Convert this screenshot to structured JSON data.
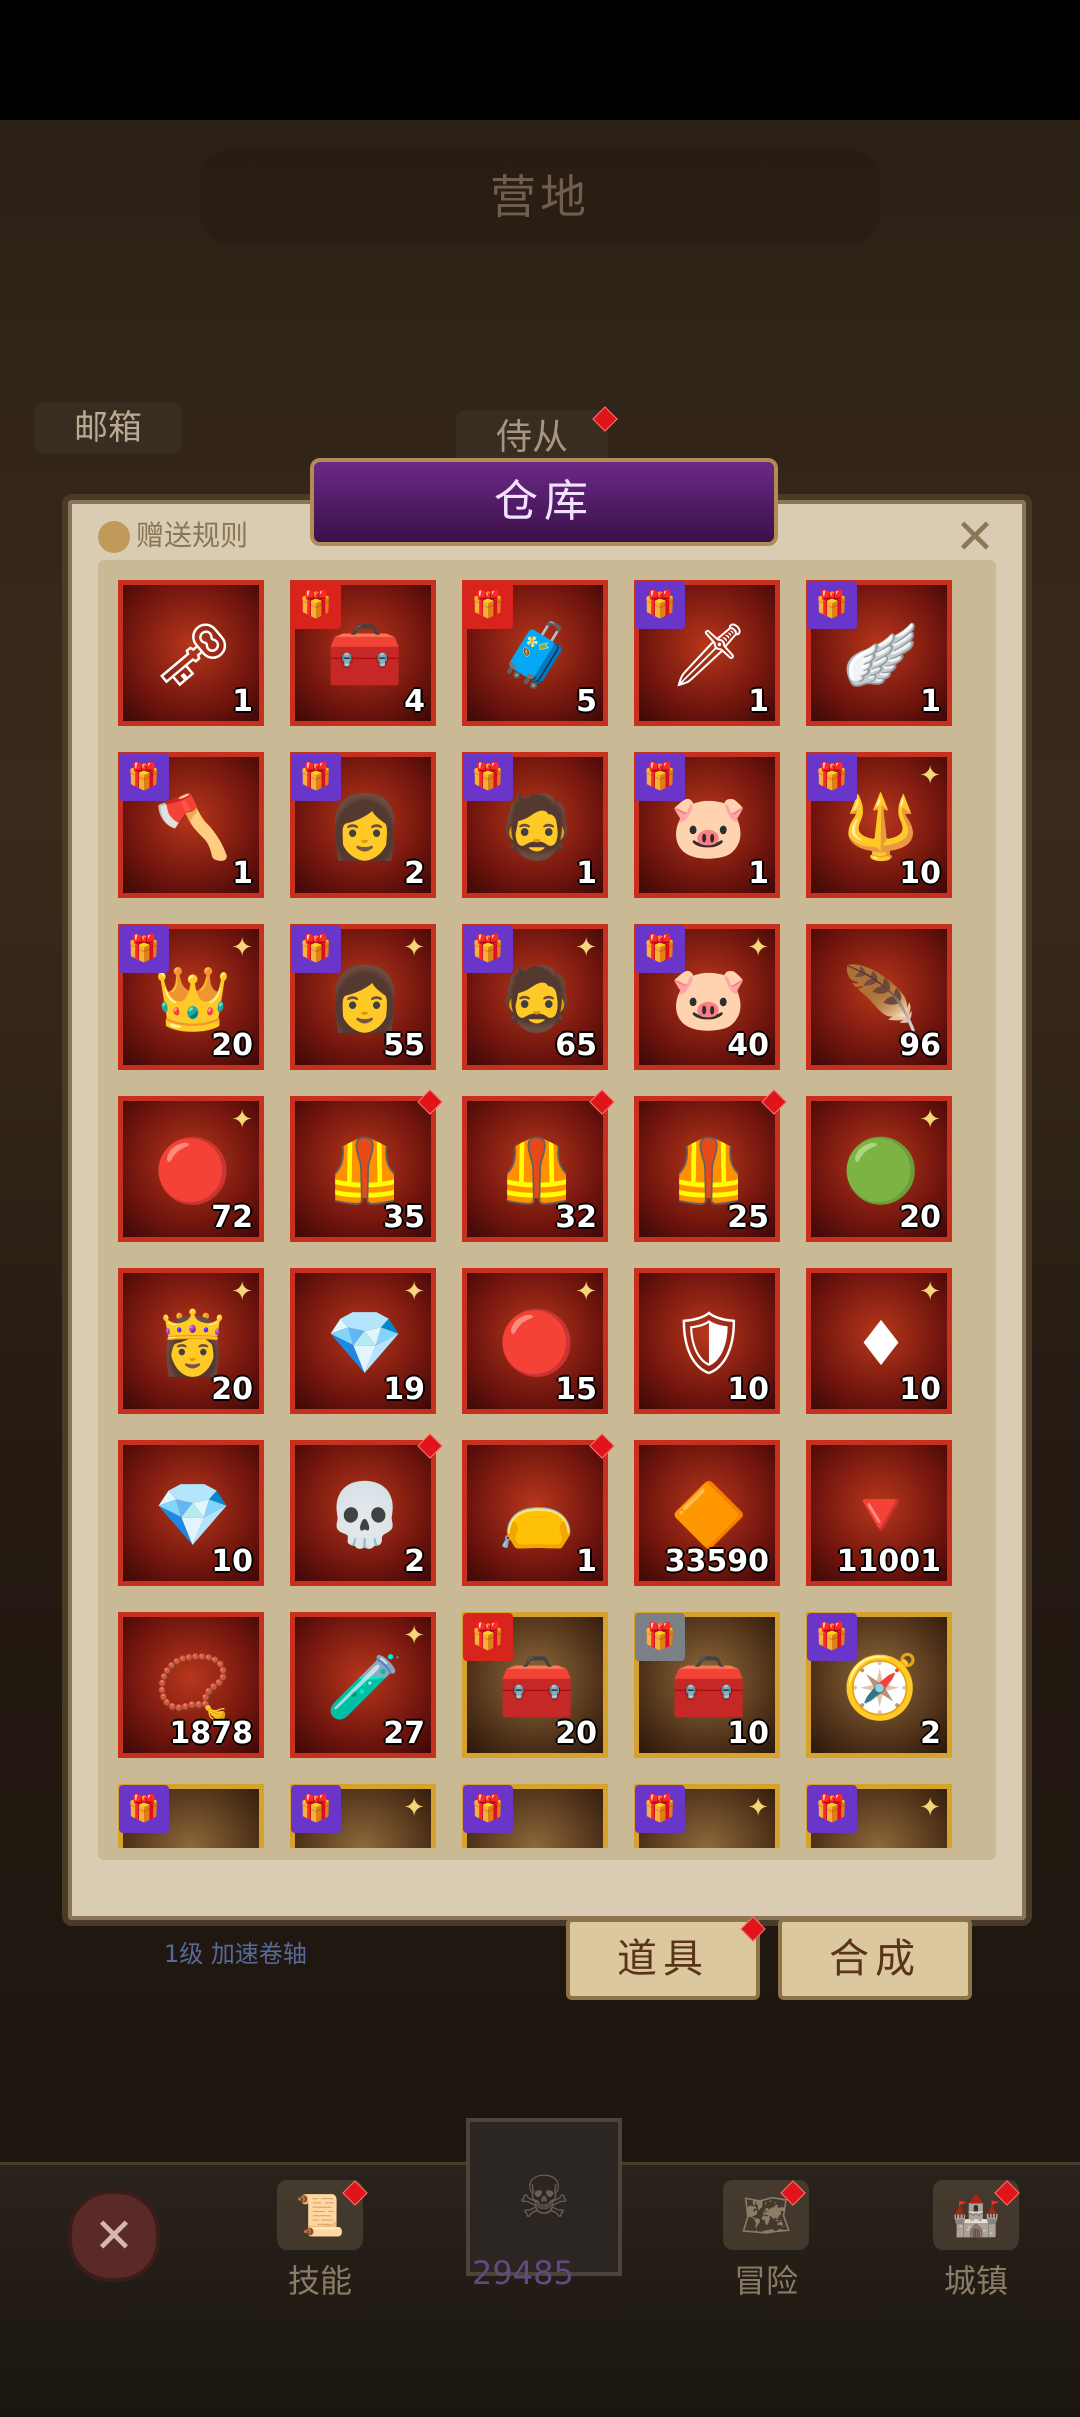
{
  "header": {
    "camp_title": "营地",
    "mailbox_label": "邮箱",
    "attendant_label": "侍从"
  },
  "warehouse": {
    "title": "仓库",
    "rules_label": "赠送规则",
    "close_glyph": "✕",
    "items": [
      {
        "icon": "key-icon",
        "glyph": "🗝",
        "qty": "1",
        "badge": null,
        "dot": false,
        "spark": false,
        "frame": "red"
      },
      {
        "icon": "treasure-chest-icon",
        "glyph": "🧰",
        "qty": "4",
        "badge": "red",
        "dot": false,
        "spark": false,
        "frame": "red"
      },
      {
        "icon": "iron-chest-icon",
        "glyph": "🧳",
        "qty": "5",
        "badge": "red",
        "dot": false,
        "spark": false,
        "frame": "red"
      },
      {
        "icon": "chainsaw-sword-icon",
        "glyph": "🗡",
        "qty": "1",
        "badge": "purple",
        "dot": false,
        "spark": false,
        "frame": "red"
      },
      {
        "icon": "winged-gem-icon",
        "glyph": "🪽",
        "qty": "1",
        "badge": "purple",
        "dot": false,
        "spark": false,
        "frame": "red"
      },
      {
        "icon": "battle-axe-icon",
        "glyph": "🪓",
        "qty": "1",
        "badge": "purple",
        "dot": false,
        "spark": false,
        "frame": "red"
      },
      {
        "icon": "hero-woman-portrait-icon",
        "glyph": "👩",
        "qty": "2",
        "badge": "purple",
        "dot": false,
        "spark": false,
        "frame": "red"
      },
      {
        "icon": "hooded-man-portrait-icon",
        "glyph": "🧔",
        "qty": "1",
        "badge": "purple",
        "dot": false,
        "spark": false,
        "frame": "red"
      },
      {
        "icon": "leopard-hat-portrait-icon",
        "glyph": "🐷",
        "qty": "1",
        "badge": "purple",
        "dot": false,
        "spark": false,
        "frame": "red"
      },
      {
        "icon": "magic-staff-icon",
        "glyph": "🔱",
        "qty": "10",
        "badge": "purple",
        "dot": false,
        "spark": true,
        "frame": "red"
      },
      {
        "icon": "crown-icon",
        "glyph": "👑",
        "qty": "20",
        "badge": "purple",
        "dot": false,
        "spark": true,
        "frame": "red"
      },
      {
        "icon": "hero-woman-shard-icon",
        "glyph": "👩",
        "qty": "55",
        "badge": "purple",
        "dot": false,
        "spark": true,
        "frame": "red"
      },
      {
        "icon": "hooded-man-shard-icon",
        "glyph": "🧔",
        "qty": "65",
        "badge": "purple",
        "dot": false,
        "spark": true,
        "frame": "red"
      },
      {
        "icon": "leopard-hat-shard-icon",
        "glyph": "🐷",
        "qty": "40",
        "badge": "purple",
        "dot": false,
        "spark": true,
        "frame": "red"
      },
      {
        "icon": "golden-feather-icon",
        "glyph": "🪶",
        "qty": "96",
        "badge": null,
        "dot": false,
        "spark": false,
        "frame": "red"
      },
      {
        "icon": "red-orb-amulet-icon",
        "glyph": "🔴",
        "qty": "72",
        "badge": null,
        "dot": false,
        "spark": true,
        "frame": "red"
      },
      {
        "icon": "armor-chestplate-icon",
        "glyph": "🦺",
        "qty": "35",
        "badge": null,
        "dot": true,
        "spark": false,
        "frame": "red"
      },
      {
        "icon": "armor-chestplate-icon",
        "glyph": "🦺",
        "qty": "32",
        "badge": null,
        "dot": true,
        "spark": false,
        "frame": "red"
      },
      {
        "icon": "armor-chestplate-icon",
        "glyph": "🦺",
        "qty": "25",
        "badge": null,
        "dot": true,
        "spark": false,
        "frame": "red"
      },
      {
        "icon": "green-orb-star-icon",
        "glyph": "🟢",
        "qty": "20",
        "badge": null,
        "dot": false,
        "spark": true,
        "frame": "red"
      },
      {
        "icon": "valkyrie-portrait-icon",
        "glyph": "👸",
        "qty": "20",
        "badge": null,
        "dot": false,
        "spark": true,
        "frame": "red"
      },
      {
        "icon": "prism-crystal-icon",
        "glyph": "💎",
        "qty": "19",
        "badge": null,
        "dot": false,
        "spark": true,
        "frame": "red"
      },
      {
        "icon": "red-orb-amulet-icon",
        "glyph": "🔴",
        "qty": "15",
        "badge": null,
        "dot": false,
        "spark": true,
        "frame": "red"
      },
      {
        "icon": "purple-shield-icon",
        "glyph": "🛡",
        "qty": "10",
        "badge": null,
        "dot": false,
        "spark": false,
        "frame": "red"
      },
      {
        "icon": "red-rune-crystal-icon",
        "glyph": "♦",
        "qty": "10",
        "badge": null,
        "dot": false,
        "spark": true,
        "frame": "red"
      },
      {
        "icon": "prism-crystal-icon",
        "glyph": "💎",
        "qty": "10",
        "badge": null,
        "dot": false,
        "spark": false,
        "frame": "red"
      },
      {
        "icon": "skull-chest-icon",
        "glyph": "💀",
        "qty": "2",
        "badge": null,
        "dot": true,
        "spark": false,
        "frame": "red"
      },
      {
        "icon": "skull-pouch-icon",
        "glyph": "👝",
        "qty": "1",
        "badge": null,
        "dot": true,
        "spark": false,
        "frame": "red"
      },
      {
        "icon": "gold-crystal-icon",
        "glyph": "🔶",
        "qty": "33590",
        "badge": null,
        "dot": false,
        "spark": false,
        "frame": "red"
      },
      {
        "icon": "red-gem-icon",
        "glyph": "🔻",
        "qty": "11001",
        "badge": null,
        "dot": false,
        "spark": false,
        "frame": "red"
      },
      {
        "icon": "ruby-pendant-icon",
        "glyph": "📿",
        "qty": "1878",
        "badge": null,
        "dot": false,
        "spark": false,
        "frame": "red"
      },
      {
        "icon": "fire-potion-icon",
        "glyph": "🧪",
        "qty": "27",
        "badge": null,
        "dot": false,
        "spark": true,
        "frame": "red"
      },
      {
        "icon": "silver-chest-icon",
        "glyph": "🧰",
        "qty": "20",
        "badge": "red",
        "dot": false,
        "spark": false,
        "frame": "gold"
      },
      {
        "icon": "silver-chest-icon",
        "glyph": "🧰",
        "qty": "10",
        "badge": "gray",
        "dot": false,
        "spark": false,
        "frame": "gold"
      },
      {
        "icon": "pocket-compass-icon",
        "glyph": "🧭",
        "qty": "2",
        "badge": "purple",
        "dot": false,
        "spark": false,
        "frame": "gold"
      },
      {
        "icon": "item-icon",
        "glyph": "",
        "qty": "",
        "badge": "purple",
        "dot": false,
        "spark": false,
        "frame": "gold"
      },
      {
        "icon": "item-icon",
        "glyph": "",
        "qty": "",
        "badge": "purple",
        "dot": false,
        "spark": true,
        "frame": "gold"
      },
      {
        "icon": "item-icon",
        "glyph": "",
        "qty": "",
        "badge": "purple",
        "dot": false,
        "spark": false,
        "frame": "gold"
      },
      {
        "icon": "item-icon",
        "glyph": "",
        "qty": "",
        "badge": "purple",
        "dot": false,
        "spark": true,
        "frame": "gold"
      },
      {
        "icon": "item-icon",
        "glyph": "",
        "qty": "",
        "badge": "purple",
        "dot": false,
        "spark": true,
        "frame": "gold"
      }
    ]
  },
  "bottom_panel": {
    "hint": "1级 加速卷轴",
    "items_button": "道具",
    "craft_button": "合成"
  },
  "nav": {
    "close_glyph": "✕",
    "skills": "技能",
    "center_count": "29485",
    "adventure": "冒险",
    "town": "城镇"
  },
  "colors": {
    "gift_red": "#d8241d",
    "gift_purple": "#6a36c9",
    "gift_gray": "#7b7f86",
    "frame_red": "#c7301f",
    "frame_gold": "#d6a22b"
  }
}
